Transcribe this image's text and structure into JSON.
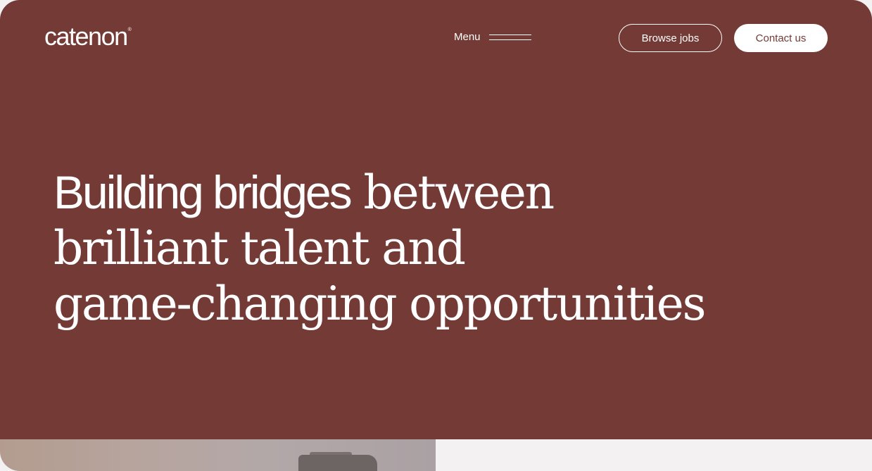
{
  "brand": {
    "logo_text": "catenon",
    "logo_mark": "®"
  },
  "nav": {
    "menu_label": "Menu",
    "browse_jobs_label": "Browse jobs",
    "contact_label": "Contact us"
  },
  "hero": {
    "headline_sans": "Building bridges",
    "headline_line1_rest": "between",
    "headline_line2": "brilliant talent and",
    "headline_line3": "game-changing opportunities"
  },
  "colors": {
    "hero_background": "#743a35",
    "text_on_hero": "#ffffff",
    "lower_panel": "#f3f1f1"
  },
  "icons": {
    "menu": "hamburger-lines-icon"
  }
}
